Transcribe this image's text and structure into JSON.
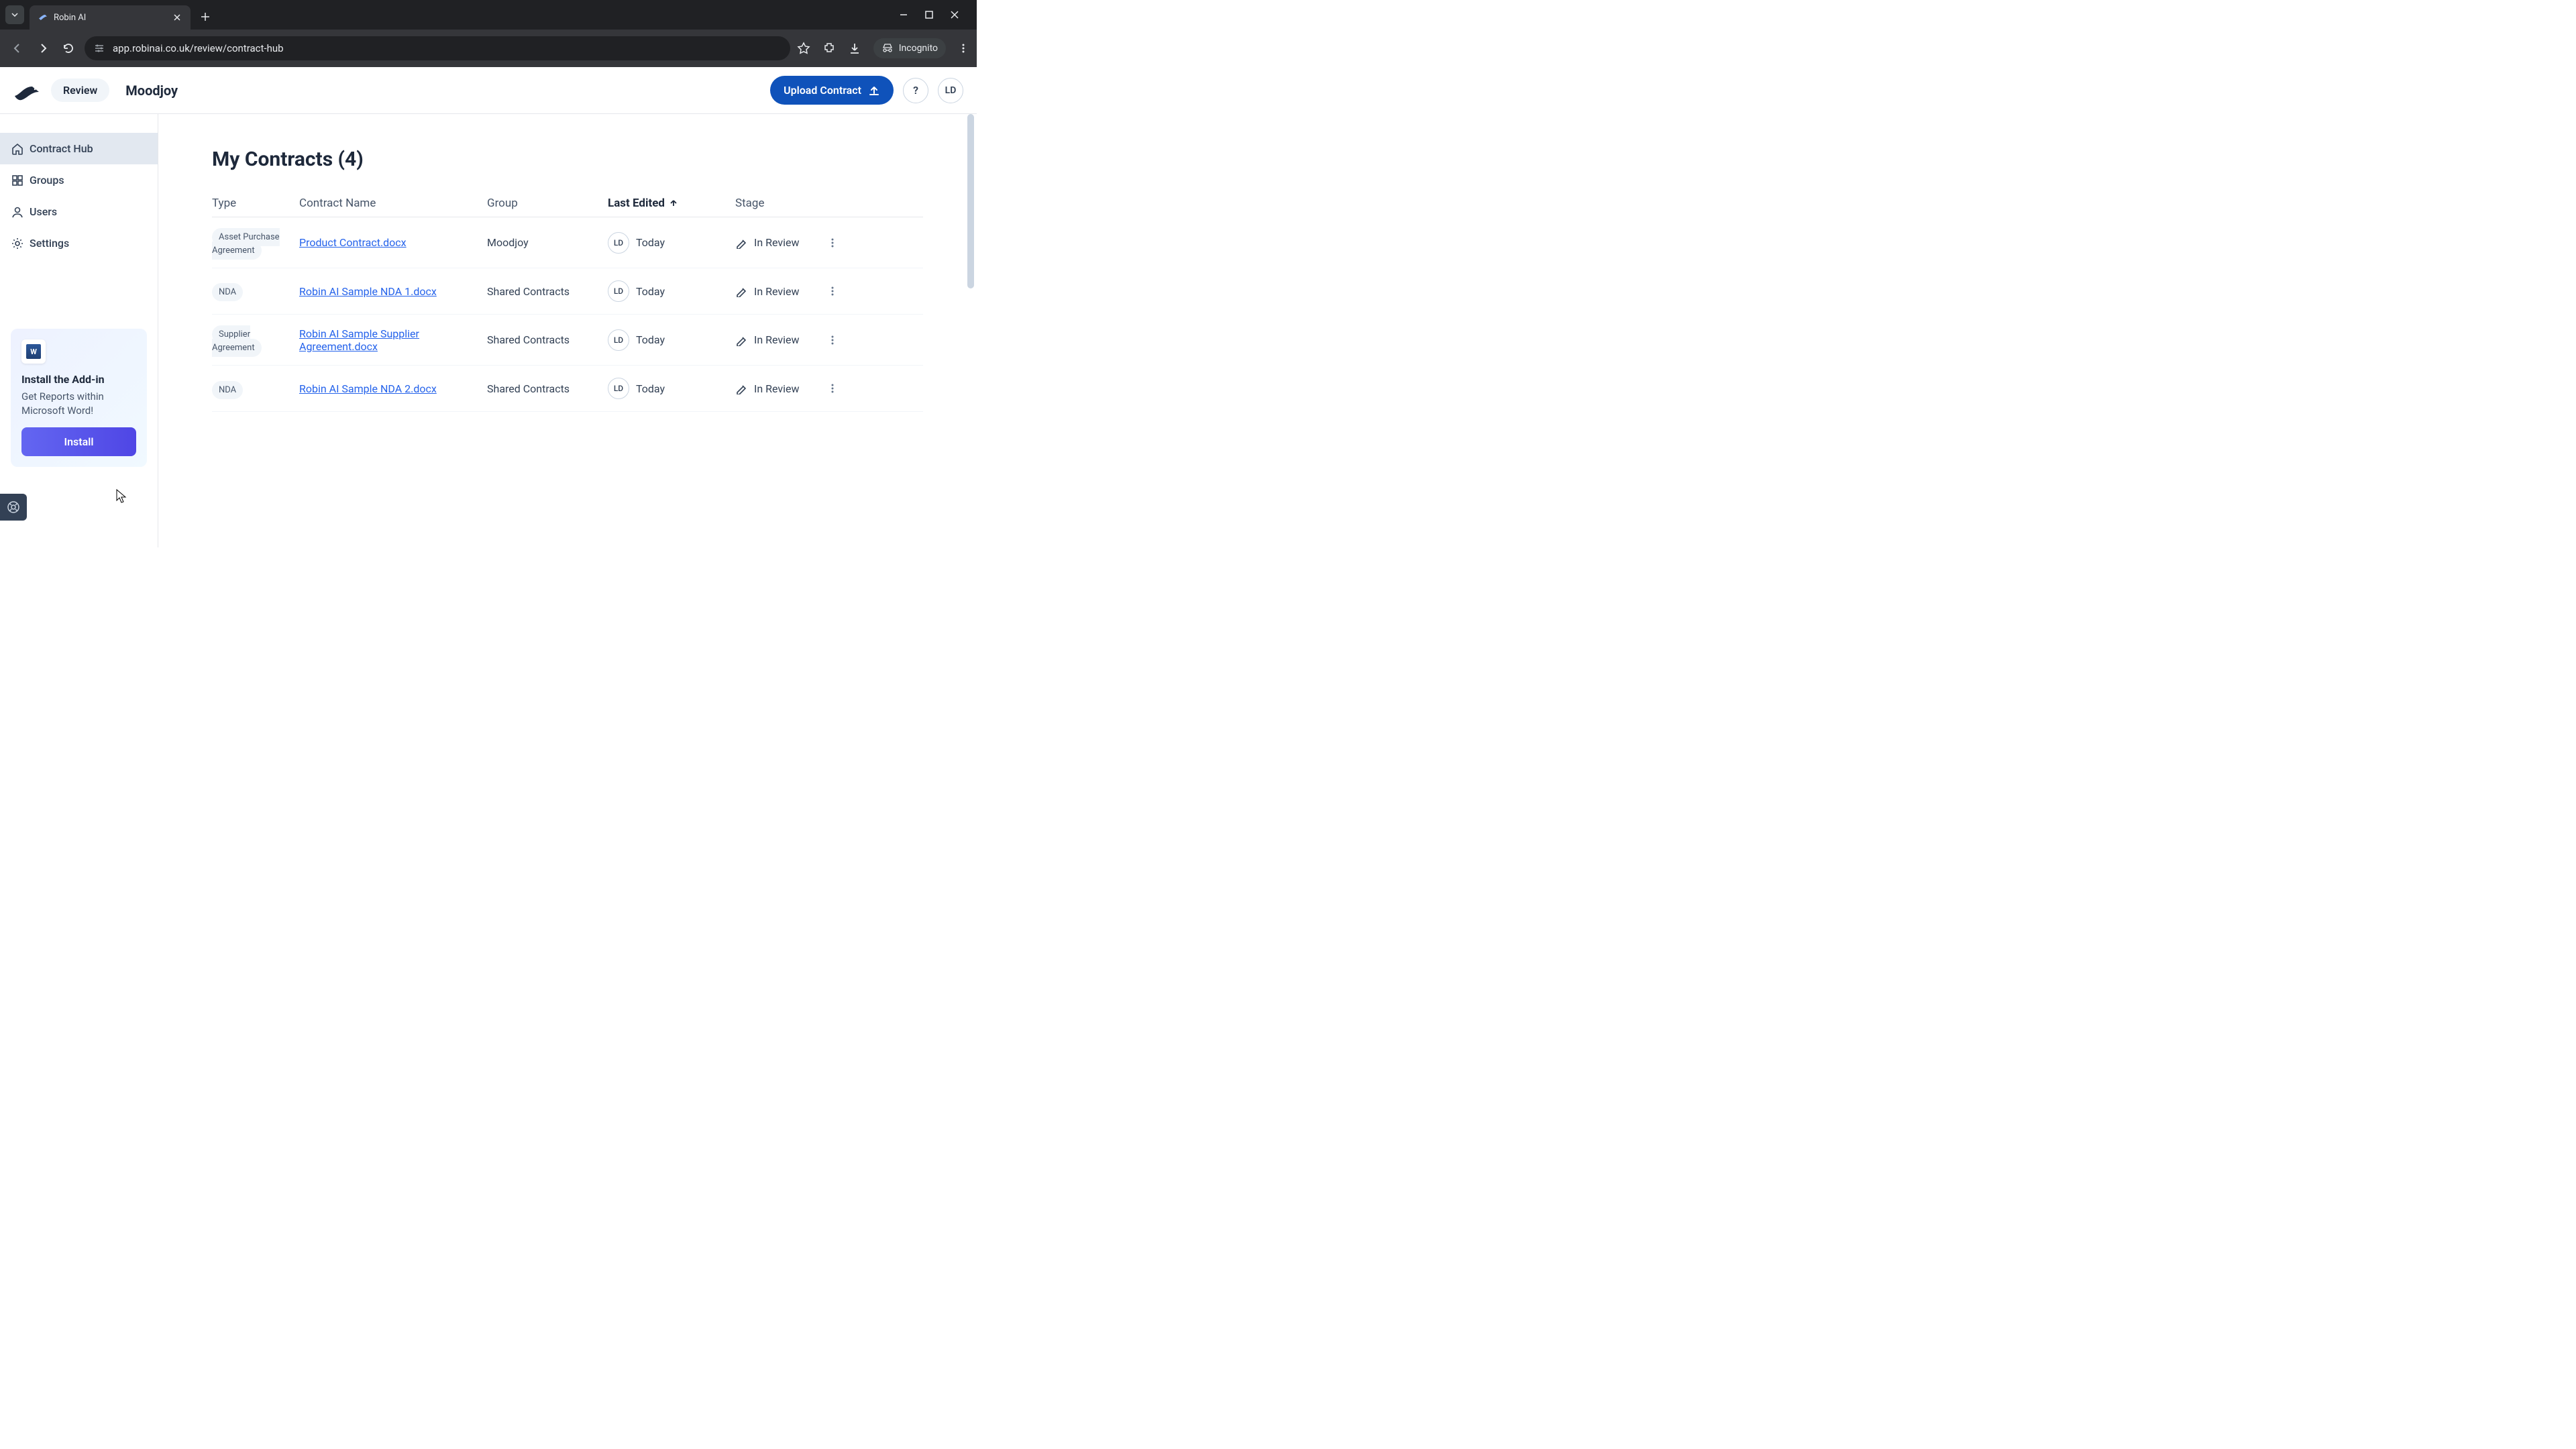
{
  "browser": {
    "tab_title": "Robin AI",
    "url": "app.robinai.co.uk/review/contract-hub",
    "incognito_label": "Incognito"
  },
  "header": {
    "review_label": "Review",
    "org_name": "Moodjoy",
    "upload_label": "Upload Contract",
    "help_label": "?",
    "avatar_initials": "LD"
  },
  "sidebar": {
    "items": [
      {
        "label": "Contract Hub"
      },
      {
        "label": "Groups"
      },
      {
        "label": "Users"
      },
      {
        "label": "Settings"
      }
    ],
    "addin": {
      "title": "Install the Add-in",
      "desc": "Get Reports within Microsoft Word!",
      "button": "Install",
      "word_letter": "W"
    }
  },
  "main": {
    "title": "My Contracts (4)",
    "columns": {
      "type": "Type",
      "name": "Contract Name",
      "group": "Group",
      "edited": "Last Edited",
      "stage": "Stage"
    },
    "rows": [
      {
        "type": "Asset Purchase Agreement",
        "name": "Product Contract.docx",
        "group": "Moodjoy",
        "editor": "LD",
        "edited": "Today",
        "stage": "In Review"
      },
      {
        "type": "NDA",
        "name": "Robin AI Sample NDA 1.docx",
        "group": "Shared Contracts",
        "editor": "LD",
        "edited": "Today",
        "stage": "In Review"
      },
      {
        "type": "Supplier Agreement",
        "name": "Robin AI Sample Supplier Agreement.docx",
        "group": "Shared Contracts",
        "editor": "LD",
        "edited": "Today",
        "stage": "In Review"
      },
      {
        "type": "NDA",
        "name": "Robin AI Sample NDA 2.docx",
        "group": "Shared Contracts",
        "editor": "LD",
        "edited": "Today",
        "stage": "In Review"
      }
    ]
  }
}
